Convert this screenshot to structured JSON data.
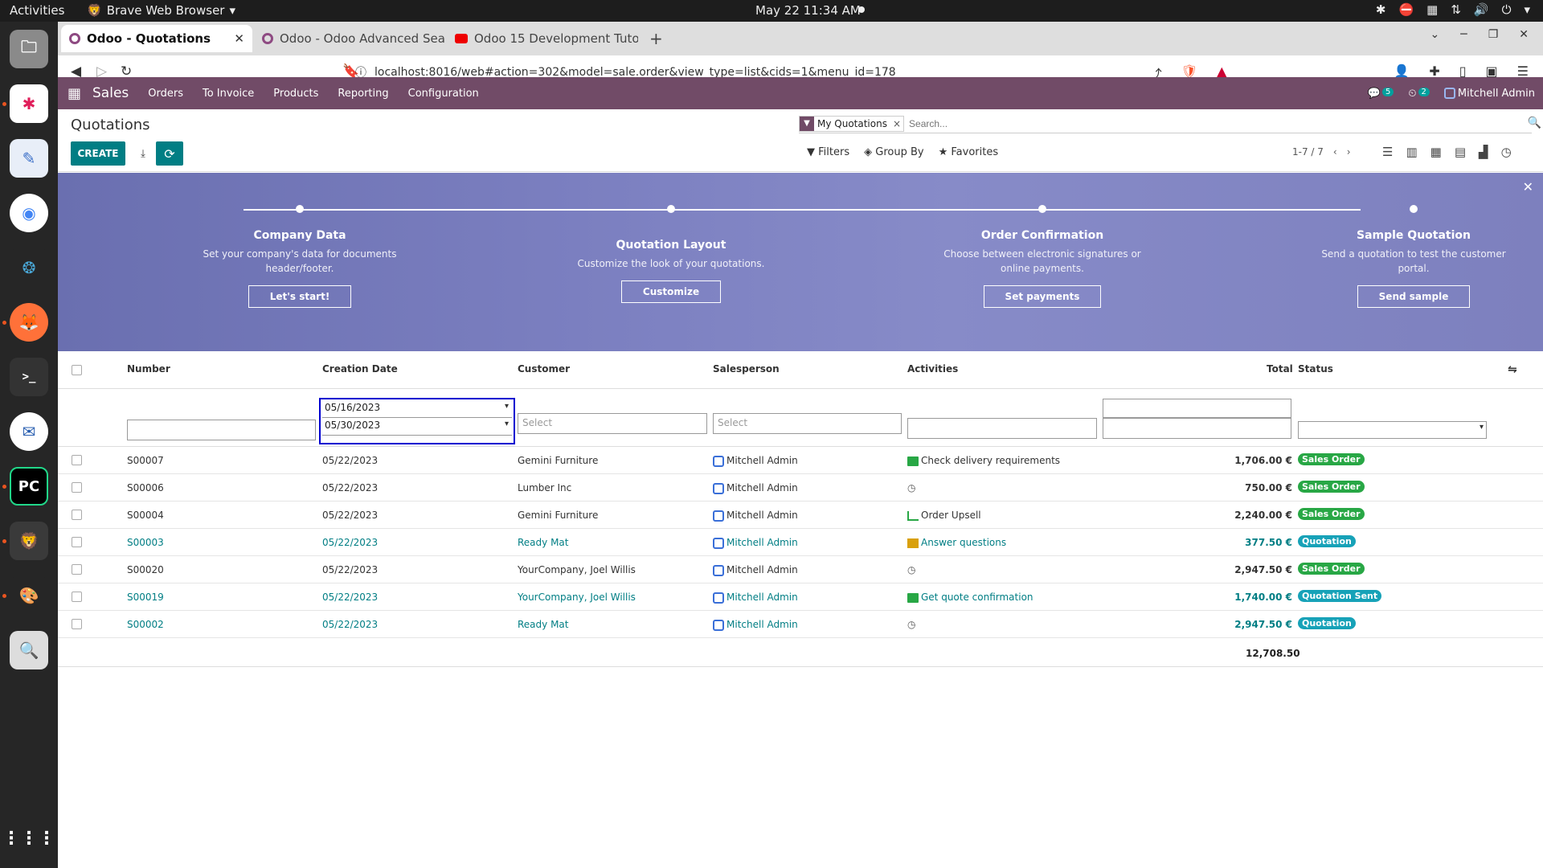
{
  "system": {
    "activities": "Activities",
    "browser": "Brave Web Browser",
    "datetime": "May 22  11:34 AM"
  },
  "tabs": [
    {
      "label": "Odoo - Quotations"
    },
    {
      "label": "Odoo - Odoo Advanced Searc"
    },
    {
      "label": "Odoo 15 Development Tutori"
    }
  ],
  "url": "localhost:8016/web#action=302&model=sale.order&view_type=list&cids=1&menu_id=178",
  "app": {
    "name": "Sales",
    "menu": [
      "Orders",
      "To Invoice",
      "Products",
      "Reporting",
      "Configuration"
    ],
    "messages_count": "5",
    "activities_count": "2",
    "user": "Mitchell Admin"
  },
  "control": {
    "title": "Quotations",
    "create": "CREATE",
    "facet": "My Quotations",
    "search_placeholder": "Search...",
    "filters": "Filters",
    "group_by": "Group By",
    "favorites": "Favorites",
    "pager": "1-7 / 7"
  },
  "banner": {
    "steps": [
      {
        "title": "Company Data",
        "text": "Set your company's data for documents header/footer.",
        "button": "Let's start!"
      },
      {
        "title": "Quotation Layout",
        "text": "Customize the look of your quotations.",
        "button": "Customize"
      },
      {
        "title": "Order Confirmation",
        "text": "Choose between electronic signatures or online payments.",
        "button": "Set payments"
      },
      {
        "title": "Sample Quotation",
        "text": "Send a quotation to test the customer portal.",
        "button": "Send sample"
      }
    ]
  },
  "columns": {
    "number": "Number",
    "date": "Creation Date",
    "customer": "Customer",
    "salesperson": "Salesperson",
    "activities": "Activities",
    "total": "Total",
    "status": "Status"
  },
  "filters": {
    "date_from": "05/16/2023",
    "date_to": "05/30/2023",
    "customer_ph": "Select",
    "salesperson_ph": "Select"
  },
  "rows": [
    {
      "number": "S00007",
      "date": "05/22/2023",
      "customer": "Gemini Furniture",
      "salesperson": "Mitchell Admin",
      "activity": "Check delivery requirements",
      "total": "1,706.00 €",
      "status": "Sales Order"
    },
    {
      "number": "S00006",
      "date": "05/22/2023",
      "customer": "Lumber Inc",
      "salesperson": "Mitchell Admin",
      "activity": "",
      "total": "750.00 €",
      "status": "Sales Order"
    },
    {
      "number": "S00004",
      "date": "05/22/2023",
      "customer": "Gemini Furniture",
      "salesperson": "Mitchell Admin",
      "activity": "Order Upsell",
      "total": "2,240.00 €",
      "status": "Sales Order"
    },
    {
      "number": "S00003",
      "date": "05/22/2023",
      "customer": "Ready Mat",
      "salesperson": "Mitchell Admin",
      "activity": "Answer questions",
      "total": "377.50 €",
      "status": "Quotation"
    },
    {
      "number": "S00020",
      "date": "05/22/2023",
      "customer": "YourCompany, Joel Willis",
      "salesperson": "Mitchell Admin",
      "activity": "",
      "total": "2,947.50 €",
      "status": "Sales Order"
    },
    {
      "number": "S00019",
      "date": "05/22/2023",
      "customer": "YourCompany, Joel Willis",
      "salesperson": "Mitchell Admin",
      "activity": "Get quote confirmation",
      "total": "1,740.00 €",
      "status": "Quotation Sent"
    },
    {
      "number": "S00002",
      "date": "05/22/2023",
      "customer": "Ready Mat",
      "salesperson": "Mitchell Admin",
      "activity": "",
      "total": "2,947.50 €",
      "status": "Quotation"
    }
  ],
  "grand_total": "12,708.50",
  "colors": {
    "odoo_purple": "#714b67",
    "teal": "#017e84",
    "sales_order": "#28a745",
    "quotation": "#17a2b8"
  }
}
